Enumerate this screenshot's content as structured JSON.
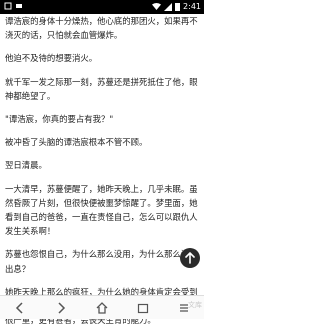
{
  "status": {
    "time": "2:41"
  },
  "paragraphs": [
    "谭浩宸的身体十分燥热，他心底的那团火，如果再不浇灭的话，只怕就会血管爆炸。",
    "他迫不及待的想要消火。",
    "就千军一发之际那一刻，苏蔓还是拼死抵住了他，眼神都绝望了。",
    "\"谭浩宸，你真的要占有我？\"",
    "被冲昏了头脑的谭浩宸根本不管不顾。",
    "翌日清晨。",
    "一大清早，苏蔓便醒了，她昨天晚上，几乎未眠。虽然昏厥了片刻，但很快便被噩梦惊醒了。梦里面，她看到自己的爸爸，一直在责怪自己，怎么可以跟仇人发生关系啊！",
    "苏蔓也怨恨自己，为什么那么没用，为什么那么没有出息？",
    "她昨天晚上那么的疯狂，为什么她的身体肯定会受到损伤，生早就说过：一个月都不要行房事，否则后果很严重，更有甚者，会丧失生育的能力。"
  ],
  "icons": {
    "scroll_top": "arrow-up-icon",
    "back": "back-icon",
    "forward": "forward-icon",
    "home": "home-icon",
    "tabs": "tabs-icon",
    "menu": "menu-icon"
  },
  "watermark": "文库"
}
